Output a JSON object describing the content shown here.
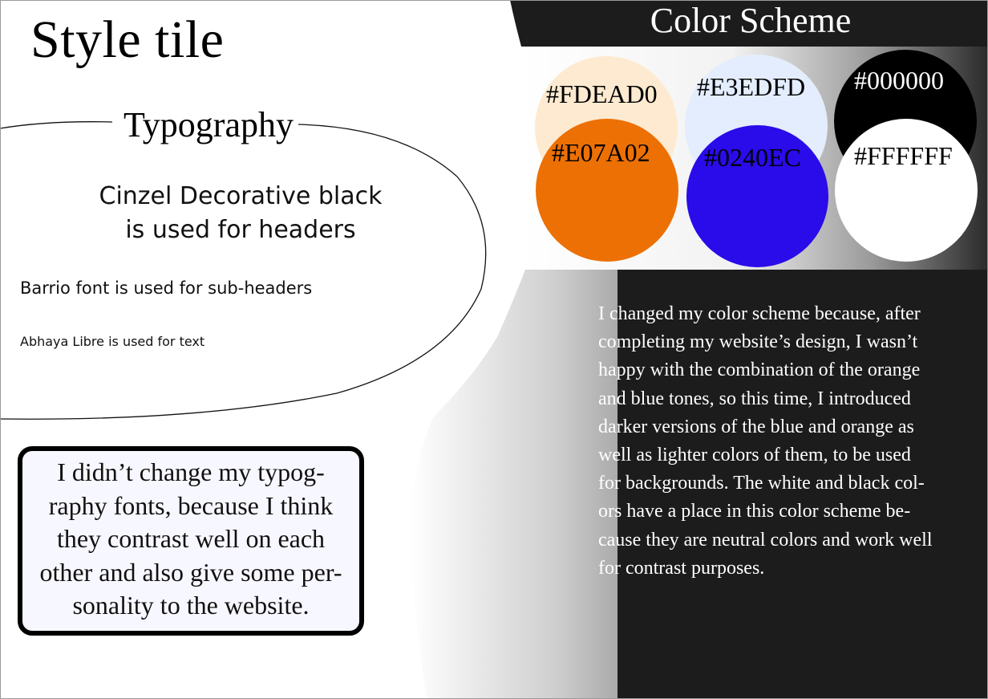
{
  "page": {
    "title": "Style tile"
  },
  "typography": {
    "heading": "Typography",
    "header_font_note_lines": [
      "Cinzel Decorative black",
      "is used for headers"
    ],
    "subheader_font_note": "Barrio font is used for sub-headers",
    "text_font_note": "Abhaya Libre is used for text",
    "explanation_lines": [
      "I didn’t change my typog-",
      "raphy fonts, because I think",
      "they contrast well on each",
      "other and also give some per-",
      "sonality to the website."
    ]
  },
  "color_scheme": {
    "heading": "Color Scheme",
    "swatches": [
      {
        "hex": "#FDEAD0",
        "label": "#FDEAD0",
        "text_color": "#000000"
      },
      {
        "hex": "#E3EDFD",
        "label": "#E3EDFD",
        "text_color": "#000000"
      },
      {
        "hex": "#000000",
        "label": "#000000",
        "text_color": "#ffffff"
      },
      {
        "hex": "#E07A02",
        "label": "#E07A02",
        "text_color": "#000000"
      },
      {
        "hex": "#0240EC",
        "label": "#0240EC",
        "text_color": "#000000"
      },
      {
        "hex": "#FFFFFF",
        "label": "#FFFFFF",
        "text_color": "#000000"
      }
    ],
    "explanation_lines": [
      "I changed my color scheme because, after",
      "completing my website’s design, I wasn’t",
      "happy with the combination of the orange",
      "and blue tones, so this time, I introduced",
      "darker versions of the blue and orange as",
      "well as lighter colors of them, to be used",
      "for backgrounds. The white and black col-",
      "ors have a place in this color scheme be-",
      "cause they are neutral colors and work well",
      "for contrast purposes."
    ]
  },
  "colors": {
    "dark_panel": "#1c1c1c",
    "swatch_orange_rendered": "#EC7004",
    "swatch_blue_rendered": "#2A0BEA"
  }
}
